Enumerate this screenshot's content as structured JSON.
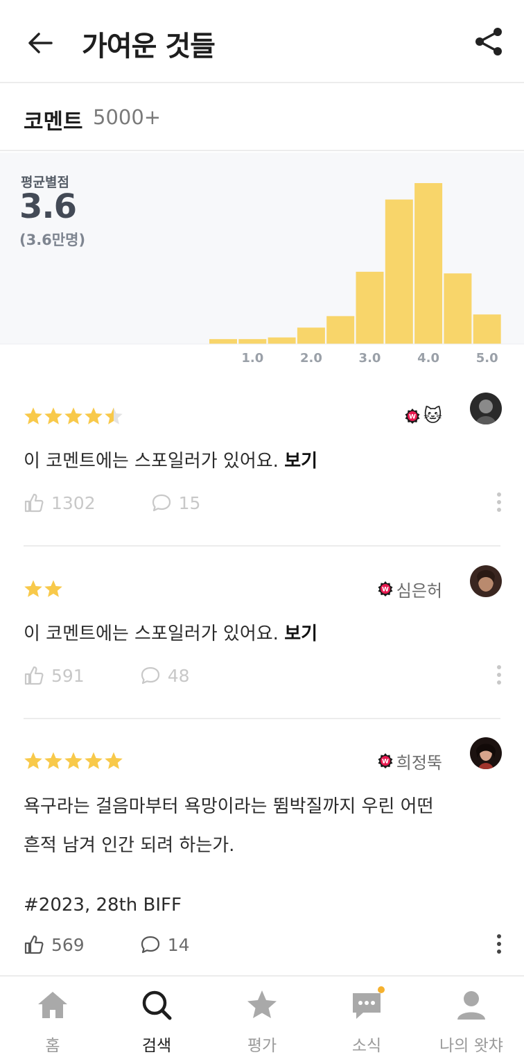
{
  "appbar": {
    "title": "가여운 것들",
    "back_icon": "arrow-left-icon",
    "share_icon": "share-icon"
  },
  "comments_header": {
    "label": "코멘트",
    "count": "5000+"
  },
  "rating_summary": {
    "label": "평균별점",
    "average": "3.6",
    "participants": "(3.6만명)"
  },
  "chart_data": {
    "type": "bar",
    "categories": [
      "0.5",
      "1.0",
      "1.5",
      "2.0",
      "2.5",
      "3.0",
      "3.5",
      "4.0",
      "4.5",
      "5.0"
    ],
    "tick_labels": [
      "1.0",
      "2.0",
      "3.0",
      "4.0",
      "5.0"
    ],
    "values": [
      3,
      3,
      4,
      10,
      17,
      44,
      88,
      98,
      43,
      18
    ],
    "value_units": "percent of tallest bar (relative, unlabeled)",
    "colors": {
      "bar": "#f8d56a",
      "bar_top": "#f6cf70"
    },
    "xlabel": "",
    "ylabel": "",
    "grid": false
  },
  "reviews": [
    {
      "rating": 4.5,
      "user_name": "",
      "user_emoji": "🐱",
      "badge": "W",
      "text": "이 코멘트에는 스포일러가 있어요.",
      "reveal": "보기",
      "likes": "1302",
      "comments": "15",
      "muted": true
    },
    {
      "rating": 2,
      "user_name": "심은허",
      "badge": "W",
      "text": "이 코멘트에는 스포일러가 있어요.",
      "reveal": "보기",
      "likes": "591",
      "comments": "48",
      "muted": true
    },
    {
      "rating": 5,
      "user_name": "희정뚝",
      "badge": "W",
      "text_line1": "욕구라는 걸음마부터 욕망이라는 뜀박질까지 우린 어떤",
      "text_line2": "흔적 남겨 인간 되려 하는가.",
      "text_line3": "#2023, 28th BIFF",
      "likes": "569",
      "comments": "14",
      "muted": false
    }
  ],
  "tabbar": {
    "items": [
      {
        "label": "홈",
        "icon": "home-icon"
      },
      {
        "label": "검색",
        "icon": "search-icon"
      },
      {
        "label": "평가",
        "icon": "star-icon"
      },
      {
        "label": "소식",
        "icon": "chat-icon"
      },
      {
        "label": "나의 왓챠",
        "icon": "person-icon"
      }
    ],
    "active": "검색"
  },
  "colors": {
    "star": "#f8c94a",
    "badge": "#e8184f",
    "muted_text": "#c4c4c4",
    "active_tab": "#1e1e1e",
    "dot": "#f5b12e"
  }
}
